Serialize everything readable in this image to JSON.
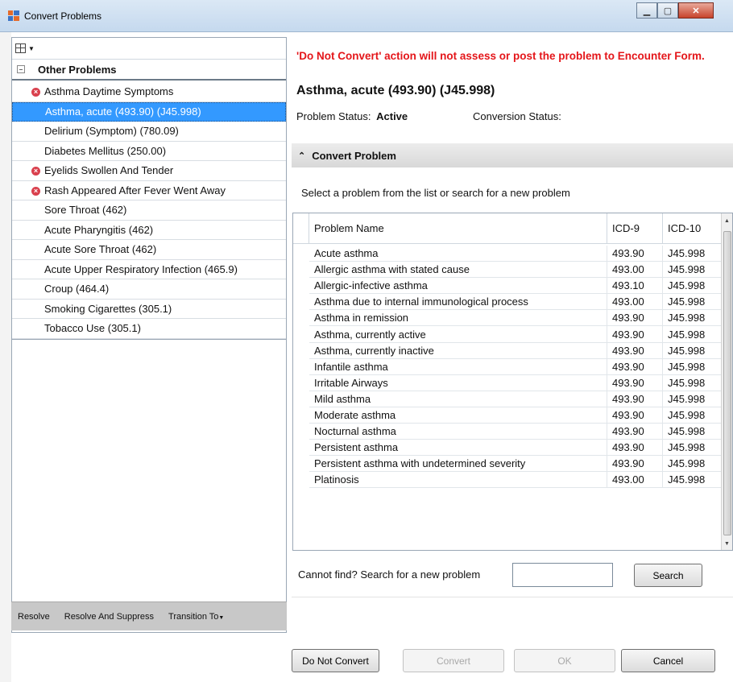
{
  "window": {
    "title": "Convert Problems"
  },
  "left": {
    "group_header": "Other Problems",
    "problems": [
      {
        "label": "Asthma Daytime Symptoms",
        "error": true,
        "selected": false
      },
      {
        "label": "Asthma, acute (493.90) (J45.998)",
        "error": false,
        "selected": true
      },
      {
        "label": "Delirium (Symptom) (780.09)",
        "error": false,
        "selected": false
      },
      {
        "label": "Diabetes Mellitus (250.00)",
        "error": false,
        "selected": false
      },
      {
        "label": "Eyelids Swollen And Tender",
        "error": true,
        "selected": false
      },
      {
        "label": "Rash Appeared After Fever Went Away",
        "error": true,
        "selected": false
      },
      {
        "label": "Sore Throat (462)",
        "error": false,
        "selected": false
      },
      {
        "label": "Acute Pharyngitis (462)",
        "error": false,
        "selected": false
      },
      {
        "label": "Acute Sore Throat (462)",
        "error": false,
        "selected": false
      },
      {
        "label": "Acute Upper Respiratory Infection (465.9)",
        "error": false,
        "selected": false
      },
      {
        "label": "Croup (464.4)",
        "error": false,
        "selected": false
      },
      {
        "label": "Smoking Cigarettes (305.1)",
        "error": false,
        "selected": false
      },
      {
        "label": "Tobacco Use (305.1)",
        "error": false,
        "selected": false
      }
    ],
    "actions": {
      "resolve": "Resolve",
      "resolve_suppress": "Resolve And Suppress",
      "transition": "Transition To"
    }
  },
  "right": {
    "warning": "'Do Not Convert' action will not assess or post the problem to Encounter Form.",
    "problem_title": "Asthma, acute (493.90) (J45.998)",
    "status_label": "Problem Status:",
    "status_value": "Active",
    "conversion_label": "Conversion Status:",
    "section_title": "Convert Problem",
    "instructions": "Select a problem from the list or search for a new problem",
    "grid": {
      "headers": {
        "name": "Problem Name",
        "icd9": "ICD-9",
        "icd10": "ICD-10"
      },
      "rows": [
        [
          "Acute asthma",
          "493.90",
          "J45.998"
        ],
        [
          "Allergic asthma with stated cause",
          "493.00",
          "J45.998"
        ],
        [
          "Allergic-infective asthma",
          "493.10",
          "J45.998"
        ],
        [
          "Asthma due to internal immunological process",
          "493.00",
          "J45.998"
        ],
        [
          "Asthma in remission",
          "493.90",
          "J45.998"
        ],
        [
          "Asthma, currently active",
          "493.90",
          "J45.998"
        ],
        [
          "Asthma, currently inactive",
          "493.90",
          "J45.998"
        ],
        [
          "Infantile asthma",
          "493.90",
          "J45.998"
        ],
        [
          "Irritable Airways",
          "493.90",
          "J45.998"
        ],
        [
          "Mild asthma",
          "493.90",
          "J45.998"
        ],
        [
          "Moderate asthma",
          "493.90",
          "J45.998"
        ],
        [
          "Nocturnal asthma",
          "493.90",
          "J45.998"
        ],
        [
          "Persistent asthma",
          "493.90",
          "J45.998"
        ],
        [
          "Persistent asthma with undetermined severity",
          "493.90",
          "J45.998"
        ],
        [
          "Platinosis",
          "493.00",
          "J45.998"
        ]
      ]
    },
    "search": {
      "label": "Cannot find? Search for a new problem",
      "value": "",
      "button": "Search"
    },
    "buttons": {
      "do_not_convert": "Do Not Convert",
      "convert": "Convert",
      "ok": "OK",
      "cancel": "Cancel"
    }
  },
  "colors": {
    "warning": "#e4161a",
    "selection": "#3399ff",
    "error_icon": "#d9404d"
  }
}
